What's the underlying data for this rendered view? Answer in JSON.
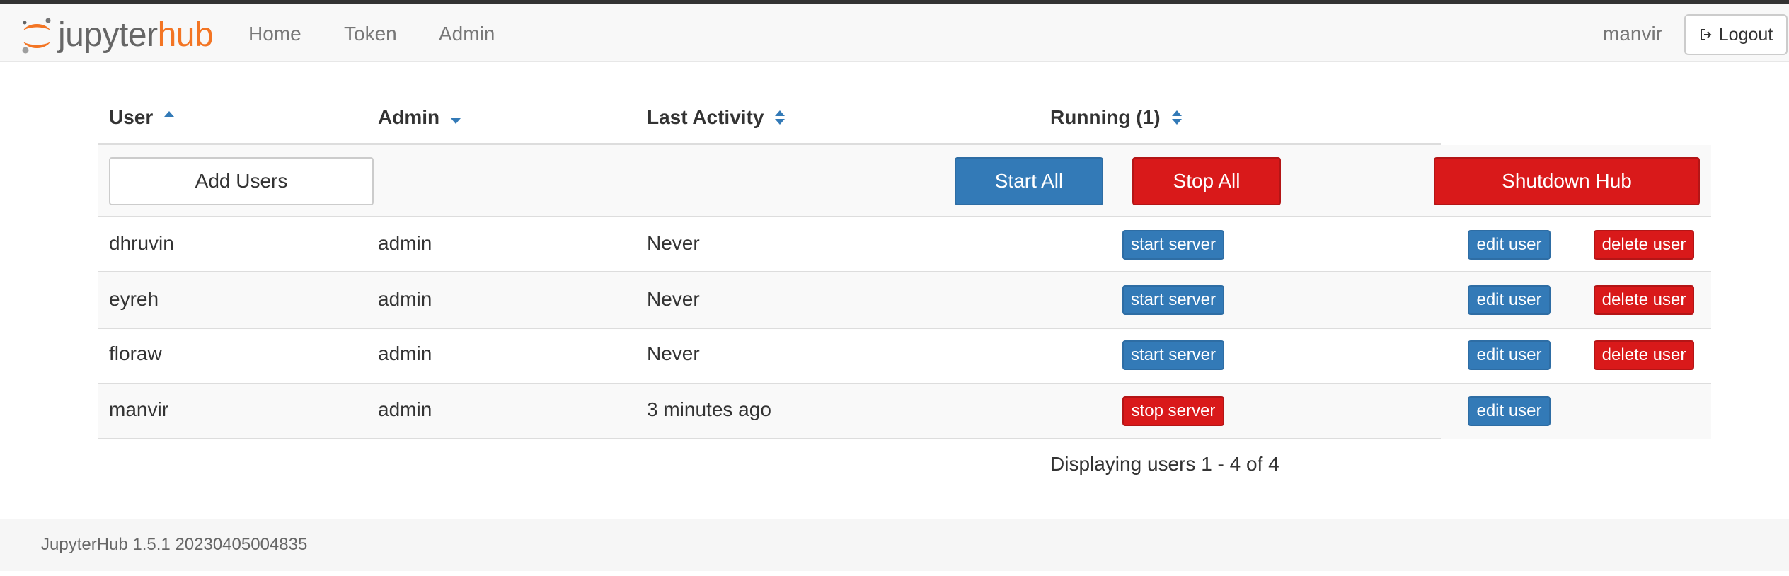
{
  "brand": {
    "jupyter": "jupyter",
    "hub": "hub",
    "accent": "#f37524"
  },
  "nav": {
    "links": [
      "Home",
      "Token",
      "Admin"
    ],
    "user": "manvir",
    "logout_label": "Logout",
    "logout_icon": "sign-out-icon"
  },
  "table": {
    "columns": [
      "User",
      "Admin",
      "Last Activity",
      "Running (1)"
    ],
    "sort_icons": [
      "sort-asc-icon",
      "sort-desc-icon",
      "sort-icon",
      "sort-icon"
    ],
    "actions": {
      "add_users": "Add Users",
      "start_all": "Start All",
      "stop_all": "Stop All",
      "shutdown_hub": "Shutdown Hub"
    },
    "rows": [
      {
        "user": "dhruvin",
        "admin": "admin",
        "last_activity": "Never",
        "server_action": "start server",
        "edit": "edit user",
        "delete": "delete user"
      },
      {
        "user": "eyreh",
        "admin": "admin",
        "last_activity": "Never",
        "server_action": "start server",
        "edit": "edit user",
        "delete": "delete user"
      },
      {
        "user": "floraw",
        "admin": "admin",
        "last_activity": "Never",
        "server_action": "start server",
        "edit": "edit user",
        "delete": "delete user"
      },
      {
        "user": "manvir",
        "admin": "admin",
        "last_activity": "3 minutes ago",
        "server_action": "stop server",
        "edit": "edit user"
      }
    ],
    "pagination": "Displaying users 1 - 4 of 4"
  },
  "colors": {
    "primary": "#337ab7",
    "danger": "#d9191a"
  },
  "footer": {
    "version": "JupyterHub 1.5.1 20230405004835"
  }
}
